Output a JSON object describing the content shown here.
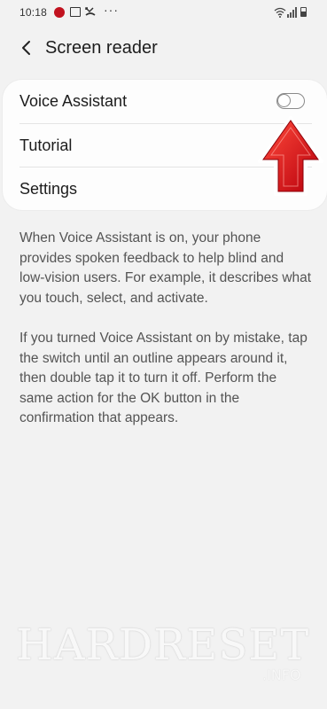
{
  "status_bar": {
    "time": "10:18",
    "dots": "···",
    "icons": [
      "app-notification-icon",
      "image-icon",
      "missed-call-icon",
      "more-notifications-icon",
      "wifi-icon",
      "signal-icon",
      "battery-icon"
    ]
  },
  "header": {
    "back_icon": "back-arrow-icon",
    "title": "Screen reader"
  },
  "settings": {
    "items": [
      {
        "label": "Voice Assistant",
        "toggle": false
      },
      {
        "label": "Tutorial"
      },
      {
        "label": "Settings"
      }
    ]
  },
  "description": {
    "paragraph1": "When Voice Assistant is on, your phone provides spoken feedback to help blind and low-vision users. For example, it describes what you touch, select, and activate.",
    "paragraph2": "If you turned Voice Assistant on by mistake, tap the switch until an outline appears around it, then double tap it to turn it off. Perform the same action for the OK button in the confirmation that appears."
  },
  "watermark": {
    "text": "HARDRESET",
    "sub": ".INFO"
  },
  "colors": {
    "background": "#f2f2f2",
    "card": "#fdfdfd",
    "arrow": "#e0141c",
    "toggle_off": "#8a8a8a"
  }
}
